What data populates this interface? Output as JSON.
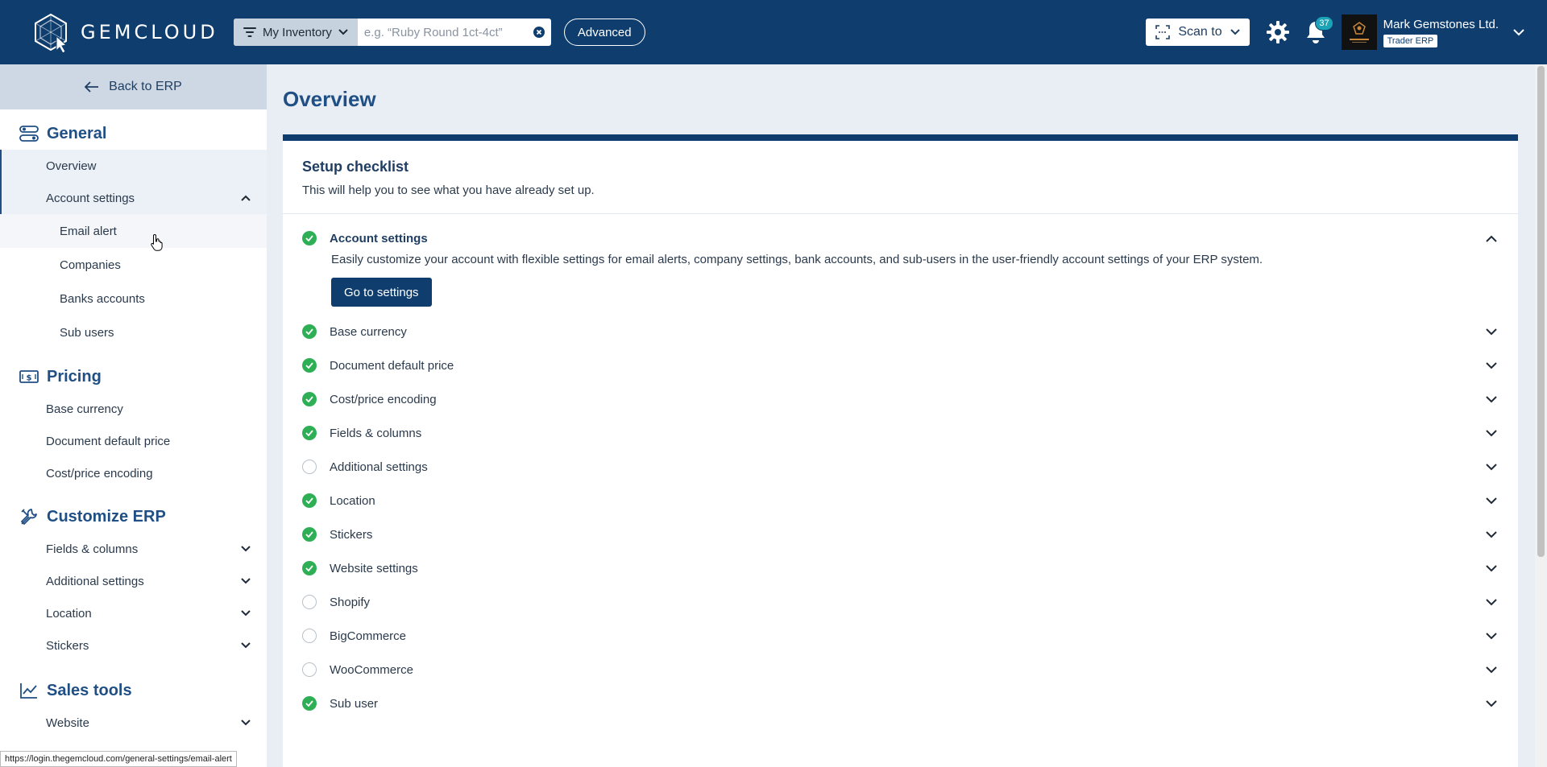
{
  "brand": {
    "name": "GEMCLOUD"
  },
  "search": {
    "scope": "My Inventory",
    "placeholder": "e.g. “Ruby Round 1ct-4ct”",
    "advanced_label": "Advanced"
  },
  "topbar": {
    "scan_label": "Scan to",
    "notifications_count": "37"
  },
  "user": {
    "name": "Mark Gemstones Ltd.",
    "role": "Trader ERP"
  },
  "sidebar": {
    "back_label": "Back to ERP",
    "general": {
      "title": "General",
      "overview": "Overview",
      "account_settings": "Account settings",
      "subs": [
        "Email alert",
        "Companies",
        "Banks accounts",
        "Sub users"
      ]
    },
    "pricing": {
      "title": "Pricing",
      "items": [
        "Base currency",
        "Document default price",
        "Cost/price encoding"
      ]
    },
    "customize": {
      "title": "Customize ERP",
      "items": [
        "Fields & columns",
        "Additional settings",
        "Location",
        "Stickers"
      ]
    },
    "sales": {
      "title": "Sales tools",
      "items": [
        "Website"
      ]
    }
  },
  "main": {
    "title": "Overview",
    "card_title": "Setup checklist",
    "card_subtitle": "This will help you to see what you have already set up.",
    "expanded": {
      "label": "Account settings",
      "description": "Easily customize your account with flexible settings for email alerts, company settings, bank accounts, and sub-users in the user-friendly account settings of your ERP system.",
      "button": "Go to settings"
    },
    "checklist": [
      {
        "label": "Base currency",
        "done": true
      },
      {
        "label": "Document default price",
        "done": true
      },
      {
        "label": "Cost/price encoding",
        "done": true
      },
      {
        "label": "Fields & columns",
        "done": true
      },
      {
        "label": "Additional settings",
        "done": false
      },
      {
        "label": "Location",
        "done": true
      },
      {
        "label": "Stickers",
        "done": true
      },
      {
        "label": "Website settings",
        "done": true
      },
      {
        "label": "Shopify",
        "done": false
      },
      {
        "label": "BigCommerce",
        "done": false
      },
      {
        "label": "WooCommerce",
        "done": false
      },
      {
        "label": "Sub user",
        "done": true
      }
    ]
  },
  "status_url": "https://login.thegemcloud.com/general-settings/email-alert",
  "colors": {
    "primary": "#0f3e6e",
    "accent": "#1f4f84",
    "success": "#2eaf55",
    "badge": "#1ba3b6"
  }
}
